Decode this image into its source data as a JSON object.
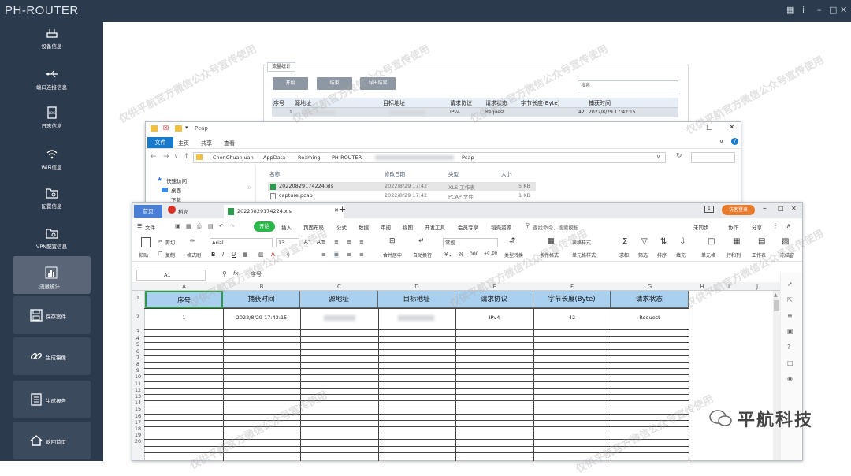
{
  "app": {
    "title": "PH-ROUTER"
  },
  "sidebar": {
    "items": [
      {
        "label": "设备信息"
      },
      {
        "label": "端口连接信息"
      },
      {
        "label": "日志信息"
      },
      {
        "label": "WiFi信息"
      },
      {
        "label": "配置信息"
      },
      {
        "label": "VPN配置信息"
      }
    ],
    "buttons": [
      {
        "label": "流量统计"
      },
      {
        "label": "保存案件"
      },
      {
        "label": "生成镜像"
      },
      {
        "label": "生成报告"
      },
      {
        "label": "返回首页"
      }
    ]
  },
  "traffic": {
    "tab": "流量统计",
    "start_label": "开始",
    "stop_label": "结束",
    "export_label": "导出结果",
    "search_placeholder": "搜索",
    "headers": [
      "序号",
      "源地址",
      "目标地址",
      "请求协议",
      "请求状态",
      "字节长度(Byte)",
      "捕获时间"
    ],
    "row": {
      "seq": "1",
      "protocol": "IPv4",
      "status": "Request",
      "bytes": "42",
      "time": "2022/8/29 17:42:15"
    }
  },
  "explorer": {
    "title": "Pcap",
    "ribbon_tabs": [
      "文件",
      "主页",
      "共享",
      "查看"
    ],
    "path": [
      "ChenChuanjuan",
      "AppData",
      "Roaming",
      "PH-ROUTER",
      "Pcap"
    ],
    "quick_access": "快速访问",
    "desktop": "桌面",
    "downloads": "下载",
    "columns": [
      "名称",
      "修改日期",
      "类型",
      "大小"
    ],
    "files": [
      {
        "name": "20220829174224.xls",
        "date": "2022/8/29 17:42",
        "type": "XLS 工作表",
        "size": "5 KB"
      },
      {
        "name": "capture.pcap",
        "date": "2022/8/29 17:42",
        "type": "PCAP 文件",
        "size": "1 KB"
      }
    ]
  },
  "sheet": {
    "tabs": [
      "首页",
      "稻壳",
      "20220829174224.xls"
    ],
    "login_label": "访客登录",
    "menu": [
      "文件",
      "开始",
      "插入",
      "页面布局",
      "公式",
      "数据",
      "审阅",
      "视图",
      "开发工具",
      "会员专享",
      "稻壳资源"
    ],
    "search_hint": "查找命令、搜索模板",
    "right_menu": [
      "未同步",
      "协作",
      "分享"
    ],
    "ribbon": {
      "paste": "粘贴",
      "cut": "剪切",
      "copy": "复制",
      "format_painter": "格式刷",
      "font": "Arial",
      "size": "13",
      "merge": "合并居中",
      "wrap": "自动换行",
      "number_format": "常规",
      "type_convert": "类型转换",
      "cond_format": "条件格式",
      "table_style": "表格样式",
      "cell_style": "单元格样式",
      "sum": "求和",
      "filter": "筛选",
      "sort": "排序",
      "fill": "填充",
      "cell": "单元格",
      "rowcol": "行和列",
      "worksheet": "工作表",
      "freeze": "冻结窗"
    },
    "cell_ref": "A1",
    "fx": "fx",
    "formula": "序号",
    "col_letters": [
      "A",
      "B",
      "C",
      "D",
      "E",
      "F",
      "G",
      "H",
      "I",
      "J"
    ],
    "headers": [
      "序号",
      "捕获时间",
      "源地址",
      "目标地址",
      "请求协议",
      "字节长度(Byte)",
      "请求状态"
    ],
    "row2": {
      "seq": "1",
      "time": "2022/8/29 17:42:15",
      "protocol": "IPv4",
      "bytes": "42",
      "status": "Request"
    },
    "row_numbers": [
      "1",
      "2",
      "3",
      "4",
      "5",
      "6",
      "7",
      "8",
      "9",
      "10",
      "11",
      "12",
      "13",
      "14",
      "15",
      "16",
      "17",
      "18",
      "19",
      "20"
    ]
  },
  "brand": {
    "logo_text": "平航科技"
  },
  "watermark": "仅供平航官方微信公众号宣传使用",
  "colors": {
    "sidebar": "#2c3a4e",
    "header_fill": "#a9d0ef",
    "start_button": "#2bb84a"
  }
}
